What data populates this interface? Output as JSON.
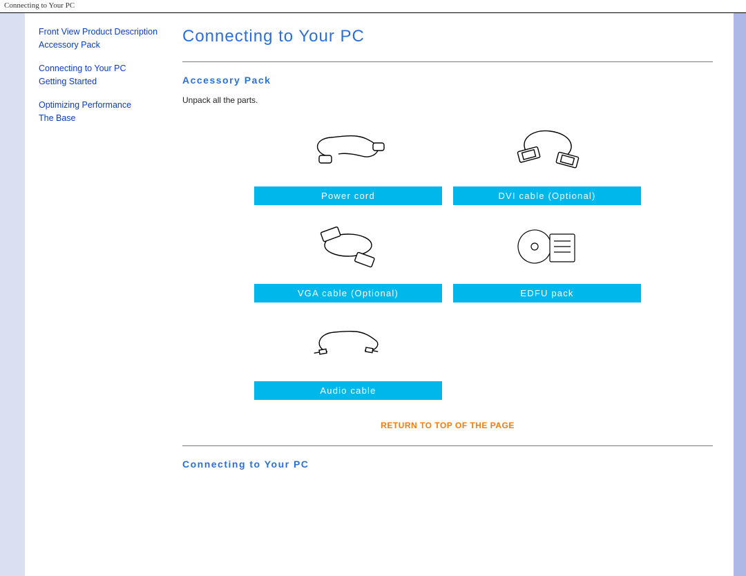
{
  "window_title": "Connecting to Your PC",
  "sidebar": {
    "items": [
      {
        "label": "Front View Product Description"
      },
      {
        "label": "Accessory Pack"
      },
      {
        "label": "Connecting to Your PC"
      },
      {
        "label": "Getting Started"
      },
      {
        "label": "Optimizing Performance"
      },
      {
        "label": "The Base"
      }
    ]
  },
  "main": {
    "title": "Connecting to Your PC",
    "section1": {
      "heading": "Accessory Pack",
      "intro": "Unpack all the parts.",
      "items": [
        {
          "label": "Power cord"
        },
        {
          "label": "DVI cable (Optional)"
        },
        {
          "label": "VGA cable (Optional)"
        },
        {
          "label": "EDFU pack"
        },
        {
          "label": "Audio cable"
        }
      ]
    },
    "return_link": "RETURN TO TOP OF THE PAGE",
    "section2": {
      "heading": "Connecting to Your PC"
    }
  }
}
